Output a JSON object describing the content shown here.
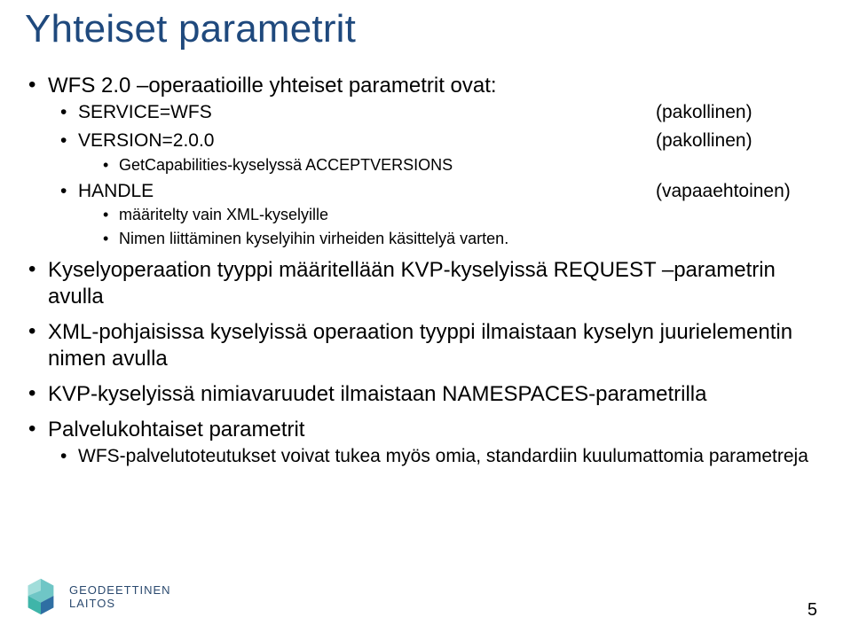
{
  "title": "Yhteiset parametrit",
  "page_number": "5",
  "logo_text": "GEODEETTINEN\nLAITOS",
  "b1": {
    "intro": "WFS 2.0 –operaatioille yhteiset parametrit ovat:",
    "p1_label": "SERVICE=WFS",
    "p1_note": "(pakollinen)",
    "p2_label": "VERSION=2.0.0",
    "p2_note": "(pakollinen)",
    "p2_sub": "GetCapabilities-kyselyssä ACCEPTVERSIONS",
    "p3_label": "HANDLE",
    "p3_note": "(vapaaehtoinen)",
    "p3_sub1": "määritelty vain XML-kyselyille",
    "p3_sub2": "Nimen liittäminen kyselyihin virheiden käsittelyä varten."
  },
  "b2": "Kyselyoperaation tyyppi määritellään KVP-kyselyissä REQUEST –parametrin avulla",
  "b3": "XML-pohjaisissa kyselyissä operaation tyyppi ilmaistaan kyselyn juurielementin nimen avulla",
  "b4": "KVP-kyselyissä nimiavaruudet ilmaistaan NAMESPACES-parametrilla",
  "b5": {
    "text": "Palvelukohtaiset parametrit",
    "sub": "WFS-palvelutoteutukset voivat tukea myös omia, standardiin kuulumattomia parametreja"
  }
}
